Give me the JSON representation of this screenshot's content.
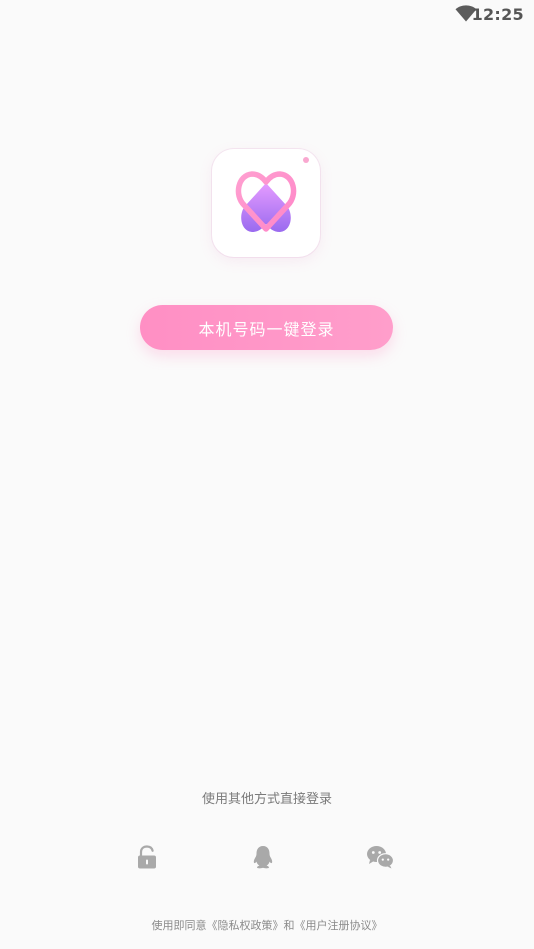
{
  "status_bar": {
    "time": "12:25",
    "wifi_icon": "wifi-icon"
  },
  "logo": {
    "icon": "heart-logo-icon",
    "colors": {
      "heart_fill_top": "#e79cff",
      "heart_fill_bottom": "#9b6cf0",
      "heart_outline": "#ff9fd0",
      "dot": "#f9a8d0"
    }
  },
  "primary_action": {
    "label": "本机号码一键登录",
    "color": "#ff96c8"
  },
  "other_methods": {
    "title": "使用其他方式直接登录",
    "icons": [
      "lock-open-icon",
      "qq-icon",
      "wechat-icon"
    ]
  },
  "footer": {
    "note": "使用即同意《隐私权政策》和《用户注册协议》"
  }
}
